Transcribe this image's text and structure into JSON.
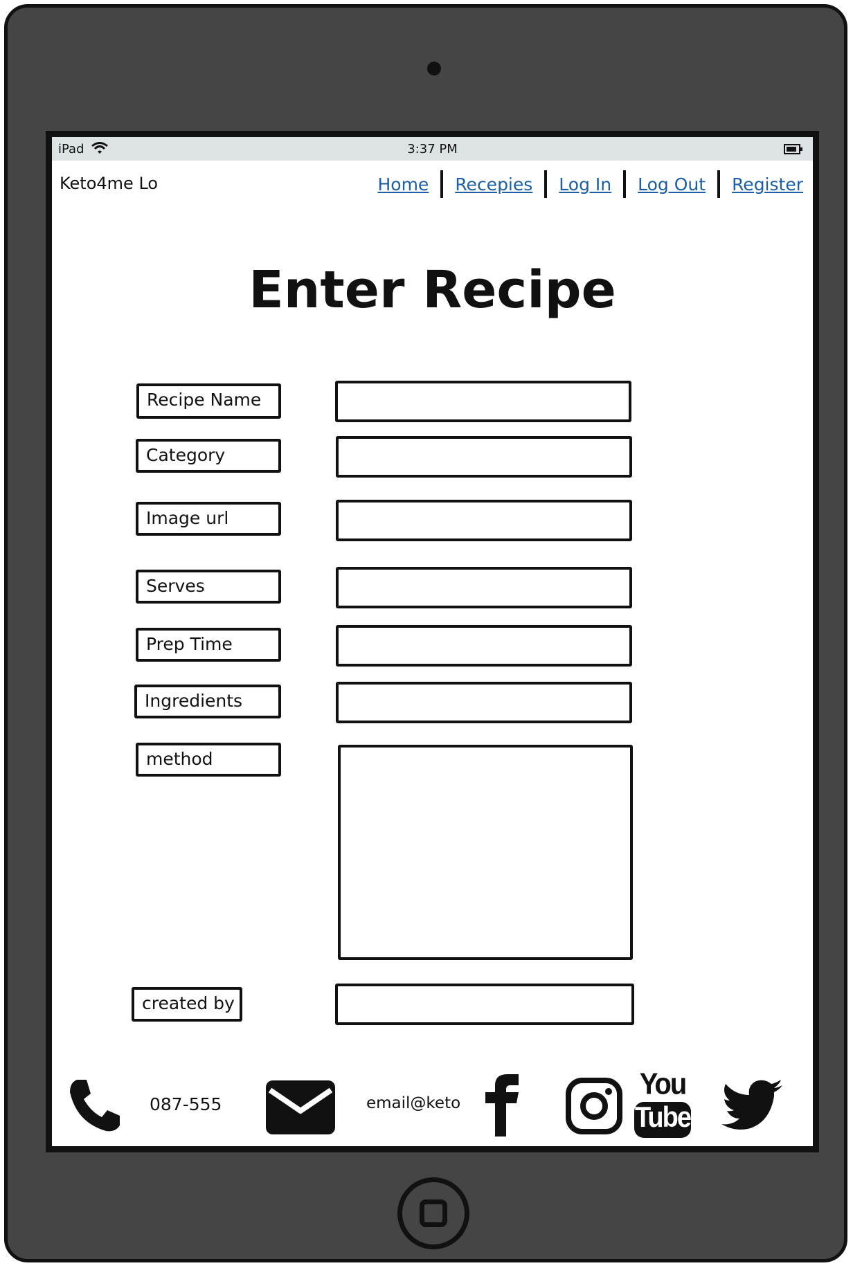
{
  "status_bar": {
    "carrier": "iPad",
    "time": "3:37 PM"
  },
  "brand": "Keto4me Lo",
  "nav": {
    "home": "Home",
    "recipes": "Recepies",
    "login": "Log In",
    "logout": "Log Out",
    "register": "Register"
  },
  "page_title": "Enter Recipe",
  "form": {
    "recipe_name": {
      "label": "Recipe Name",
      "value": ""
    },
    "category": {
      "label": "Category",
      "value": ""
    },
    "image_url": {
      "label": "Image url",
      "value": ""
    },
    "serves": {
      "label": "Serves",
      "value": ""
    },
    "prep_time": {
      "label": "Prep Time",
      "value": ""
    },
    "ingredients": {
      "label": "Ingredients",
      "value": ""
    },
    "method": {
      "label": "method",
      "value": ""
    },
    "created_by": {
      "label": "created by",
      "value": ""
    }
  },
  "footer": {
    "phone": "087-555",
    "email": "email@keto",
    "icons": [
      "phone-icon",
      "envelope-icon",
      "facebook-icon",
      "instagram-icon",
      "youtube-icon",
      "twitter-icon"
    ],
    "youtube_you": "You",
    "youtube_tube": "Tube"
  },
  "colors": {
    "device": "#454545",
    "status_bar": "#dde2e5",
    "link": "#1d5fa6"
  }
}
